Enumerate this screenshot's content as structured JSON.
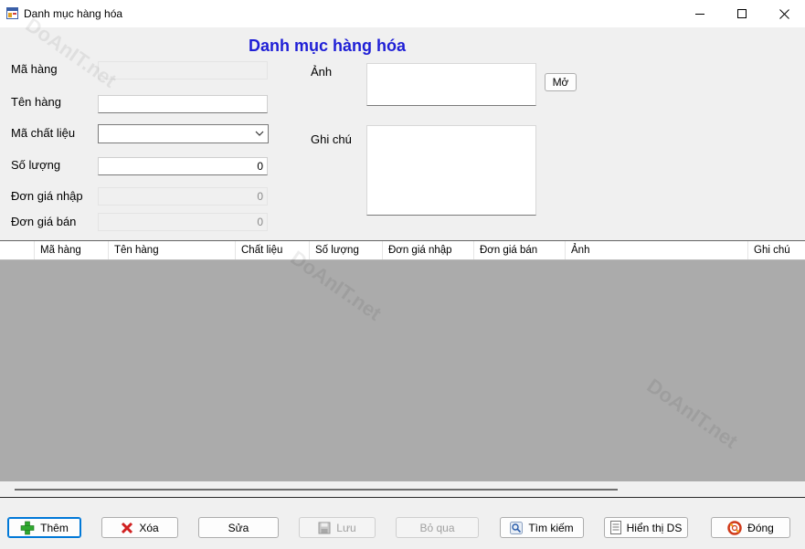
{
  "window": {
    "title": "Danh mục hàng hóa",
    "icon": "form-app-icon",
    "controls": [
      "minimize",
      "maximize",
      "close"
    ]
  },
  "form": {
    "heading": "Danh mục hàng hóa",
    "heading_color": "#1f1fd6",
    "labels": {
      "ma_hang": "Mã hàng",
      "ten_hang": "Tên hàng",
      "ma_chat_lieu": "Mã chất liệu",
      "so_luong": "Số lượng",
      "don_gia_nhap": "Đơn giá nhập",
      "don_gia_ban": "Đơn giá bán",
      "anh": "Ảnh",
      "ghi_chu": "Ghi chú"
    },
    "values": {
      "ma_hang": "",
      "ten_hang": "",
      "ma_chat_lieu": "",
      "so_luong": "0",
      "don_gia_nhap": "0",
      "don_gia_ban": "0",
      "anh": "",
      "ghi_chu": ""
    },
    "open_button": "Mở"
  },
  "grid": {
    "columns": [
      "Mã hàng",
      "Tên hàng",
      "Chất liệu",
      "Số lượng",
      "Đơn giá nhập",
      "Đơn giá bán",
      "Ảnh",
      "Ghi chú"
    ],
    "rows": [],
    "background": "#ababab"
  },
  "toolbar": {
    "them": "Thêm",
    "xoa": "Xóa",
    "sua": "Sửa",
    "luu": "Lưu",
    "bo_qua": "Bỏ qua",
    "tim_kiem": "Tìm kiếm",
    "hien_thi_ds": "Hiển thị DS",
    "dong": "Đóng"
  },
  "watermark": {
    "text": "DoAnIT.net"
  }
}
